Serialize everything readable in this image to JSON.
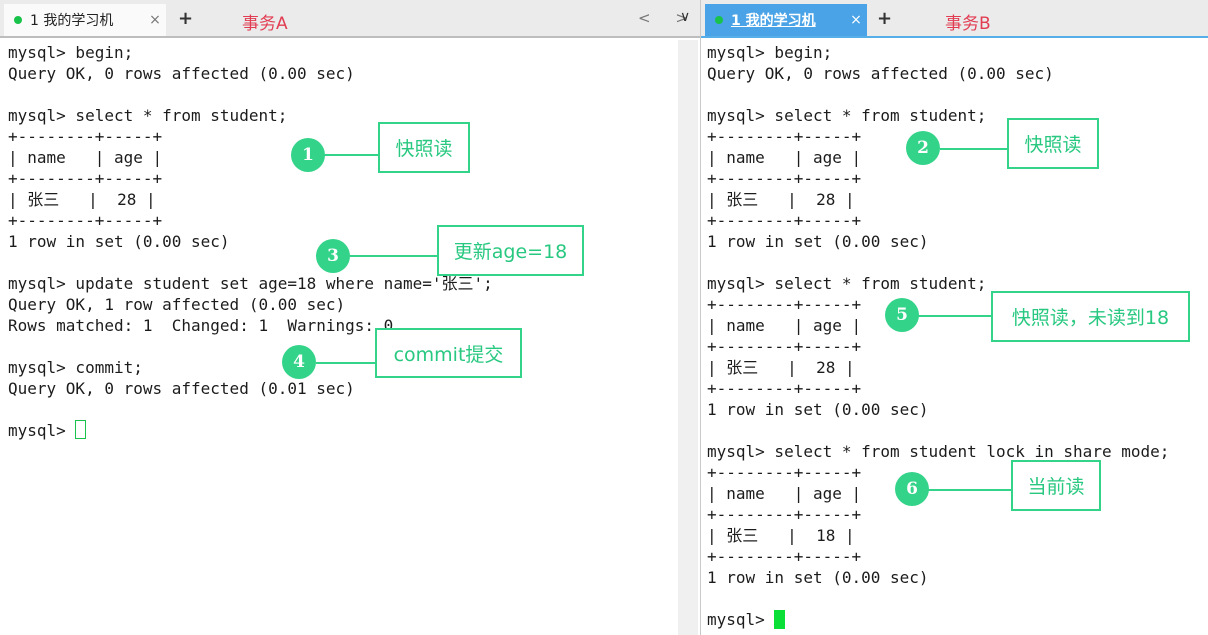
{
  "tabs": {
    "a": {
      "label": "1 我的学习机",
      "close": "×",
      "plus": "+",
      "transaction": "事务A",
      "nav": "< >",
      "chevron": "∨"
    },
    "b": {
      "label": "1 我的学习机",
      "close": "×",
      "plus": "+",
      "transaction": "事务B"
    }
  },
  "terminal_a": {
    "lines": [
      "mysql> begin;",
      "Query OK, 0 rows affected (0.00 sec)",
      "",
      "mysql> select * from student;",
      "+--------+-----+",
      "| name   | age |",
      "+--------+-----+",
      "| 张三   |  28 |",
      "+--------+-----+",
      "1 row in set (0.00 sec)",
      "",
      "mysql> update student set age=18 where name='张三';",
      "Query OK, 1 row affected (0.00 sec)",
      "Rows matched: 1  Changed: 1  Warnings: 0",
      "",
      "mysql> commit;",
      "Query OK, 0 rows affected (0.01 sec)",
      "",
      "mysql> "
    ]
  },
  "terminal_b": {
    "lines": [
      "mysql> begin;",
      "Query OK, 0 rows affected (0.00 sec)",
      "",
      "mysql> select * from student;",
      "+--------+-----+",
      "| name   | age |",
      "+--------+-----+",
      "| 张三   |  28 |",
      "+--------+-----+",
      "1 row in set (0.00 sec)",
      "",
      "mysql> select * from student;",
      "+--------+-----+",
      "| name   | age |",
      "+--------+-----+",
      "| 张三   |  28 |",
      "+--------+-----+",
      "1 row in set (0.00 sec)",
      "",
      "mysql> select * from student lock in share mode;",
      "+--------+-----+",
      "| name   | age |",
      "+--------+-----+",
      "| 张三   |  18 |",
      "+--------+-----+",
      "1 row in set (0.00 sec)",
      "",
      "mysql> "
    ]
  },
  "annotations": {
    "n1": "1",
    "c1": "快照读",
    "n2": "2",
    "c2": "快照读",
    "n3": "3",
    "c3": "更新age=18",
    "n4": "4",
    "c4": "commit提交",
    "n5": "5",
    "c5": "快照读，未读到18",
    "n6": "6",
    "c6": "当前读"
  },
  "colors": {
    "accent": "#34d38a",
    "tab_active": "#4aa3e6",
    "tx_label": "#e23c52",
    "cursor": "#0adf38"
  }
}
